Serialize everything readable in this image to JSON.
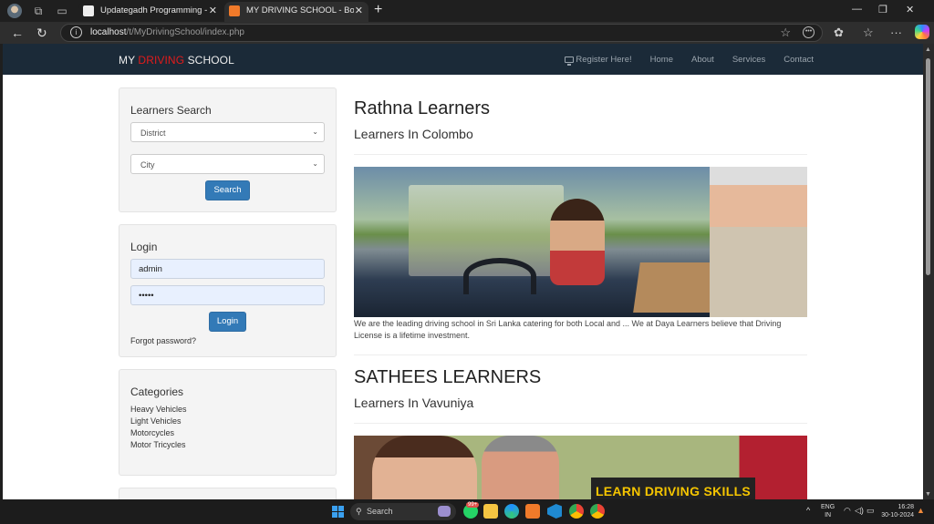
{
  "browser": {
    "tabs": [
      {
        "title": "Updategadh Programming - Upd",
        "active": false,
        "favicon": "updategadh-icon"
      },
      {
        "title": "MY DRIVING SCHOOL - Book You",
        "active": true,
        "favicon": "xampp-icon"
      }
    ],
    "url_host": "localhost",
    "url_path": "/t/MyDrivingSchool/index.php"
  },
  "site": {
    "brand": {
      "part1": "MY ",
      "part2": "DRIVING",
      "part3": " SCHOOL"
    },
    "nav": [
      {
        "label": "Register Here!",
        "icon": "monitor-icon"
      },
      {
        "label": "Home"
      },
      {
        "label": "About"
      },
      {
        "label": "Services"
      },
      {
        "label": "Contact"
      }
    ],
    "colors": {
      "navbar": "#1b2a38",
      "brand_accent": "#e31b1b",
      "button": "#337ab7"
    }
  },
  "sidebar": {
    "search": {
      "title": "Learners Search",
      "district_placeholder": "District",
      "city_placeholder": "City",
      "button": "Search"
    },
    "login": {
      "title": "Login",
      "username": "admin",
      "password": "•••••",
      "button": "Login",
      "forgot": "Forgot password?"
    },
    "categories": {
      "title": "Categories",
      "items": [
        "Heavy Vehicles",
        "Light Vehicles",
        "Motorcycles",
        "Motor Tricycles"
      ]
    }
  },
  "main": {
    "schools": [
      {
        "name": "Rathna Learners",
        "location": "Learners In Colombo",
        "description": "We are the leading driving school in Sri Lanka catering for both Local and ... We at Daya Learners believe that Driving License is a lifetime investment."
      },
      {
        "name": "SATHEES LEARNERS",
        "location": "Learners In Vavuniya",
        "banner_text": "LEARN DRIVING SKILLS"
      }
    ]
  },
  "taskbar": {
    "search_label": "Search",
    "notification_badge": "99+",
    "lang_top": "ENG",
    "lang_bottom": "IN",
    "time": "16:28",
    "date": "30-10-2024"
  }
}
